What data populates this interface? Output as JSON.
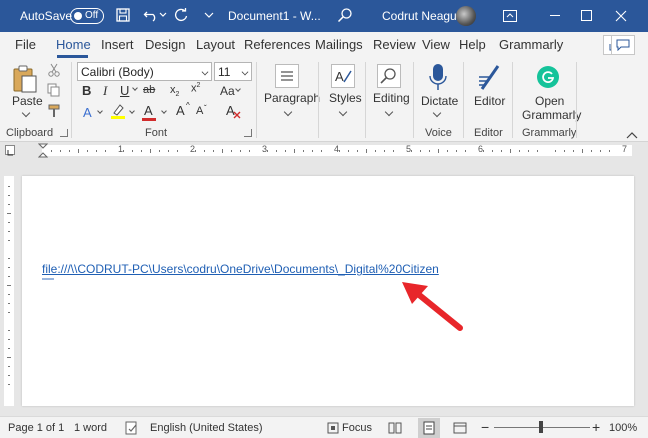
{
  "titlebar": {
    "autosave_label": "AutoSave",
    "autosave_state": "Off",
    "document_title": "Document1 - W...",
    "user_name": "Codrut Neagu"
  },
  "tabs": [
    "File",
    "Home",
    "Insert",
    "Design",
    "Layout",
    "References",
    "Mailings",
    "Review",
    "View",
    "Help",
    "Grammarly"
  ],
  "active_tab": "Home",
  "ribbon": {
    "clipboard": {
      "paste_label": "Paste",
      "group_label": "Clipboard"
    },
    "font": {
      "font_name": "Calibri (Body)",
      "font_size": "11",
      "group_label": "Font",
      "bold": "B",
      "italic": "I",
      "underline": "U",
      "strikethrough": "ab",
      "subscript": "x",
      "superscript": "x",
      "grow_font": "A",
      "shrink_font": "A",
      "change_case": "Aa",
      "clear_format": "A",
      "highlight_color": "#ffff00",
      "font_color": "#d12c2c"
    },
    "paragraph_label": "Paragraph",
    "styles_label": "Styles",
    "editing_label": "Editing",
    "voice": {
      "dictate_label": "Dictate",
      "group_label": "Voice"
    },
    "editor": {
      "editor_label": "Editor",
      "group_label": "Editor"
    },
    "grammarly": {
      "open_label_1": "Open",
      "open_label_2": "Grammarly",
      "group_label": "Grammarly"
    }
  },
  "ruler": {
    "marks": [
      "1",
      "2",
      "3",
      "4",
      "5",
      "6",
      "7"
    ]
  },
  "document": {
    "hyperlink_text": "file:///\\\\CODRUT-PC\\Users\\codru\\OneDrive\\Documents\\_Digital%20Citizen"
  },
  "statusbar": {
    "page": "Page 1 of 1",
    "words": "1 word",
    "language": "English (United States)",
    "focus": "Focus",
    "zoom": "100%"
  },
  "colors": {
    "brand": "#2b579a",
    "hyperlink": "#1f5fb4",
    "arrow": "#e8262a"
  }
}
